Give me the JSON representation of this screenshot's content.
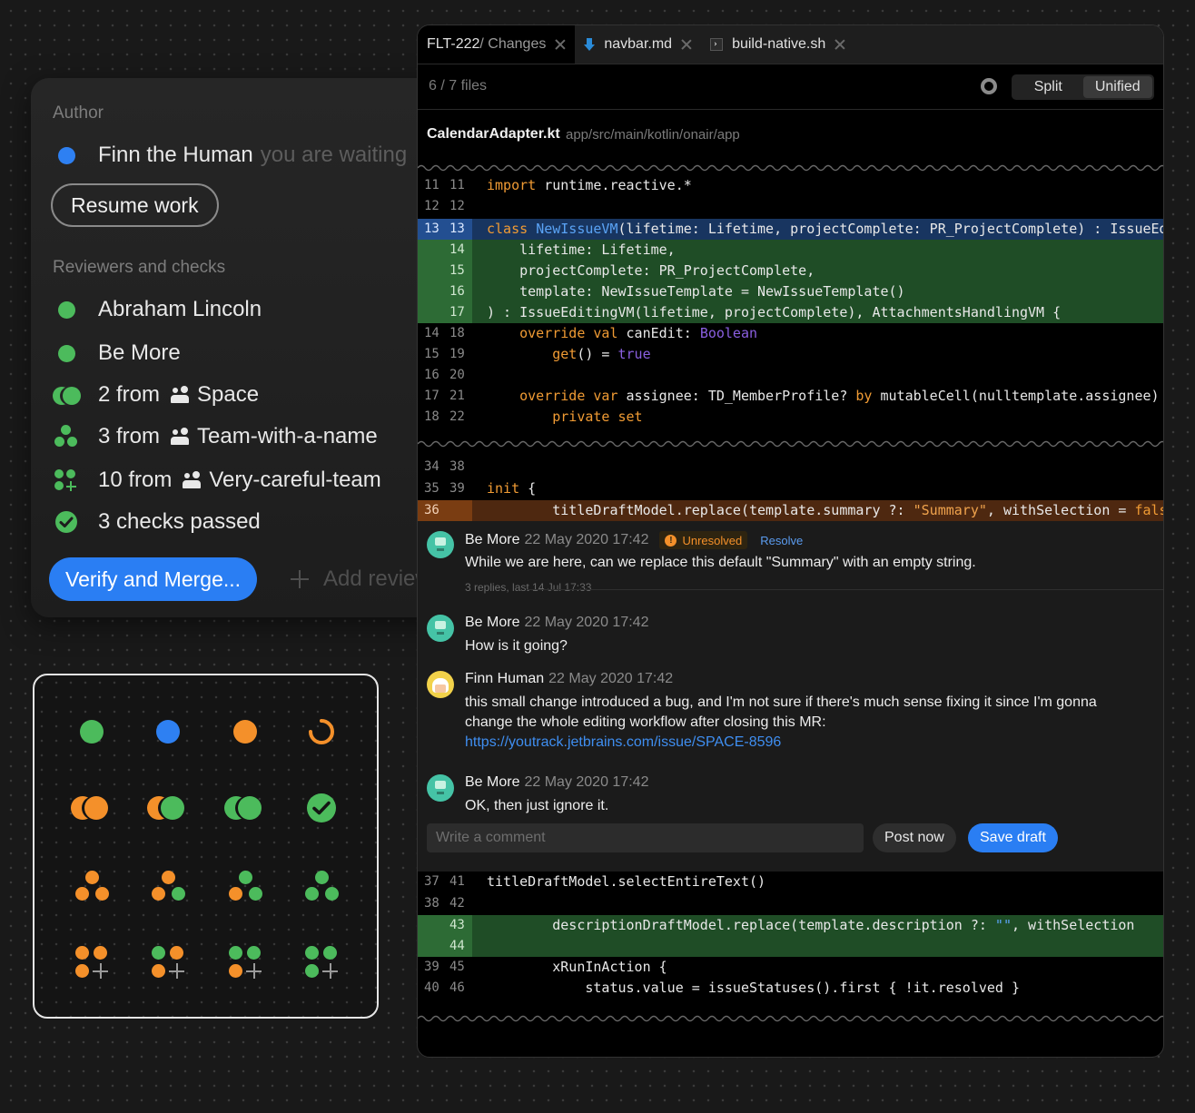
{
  "review_panel": {
    "author_label": "Author",
    "author": {
      "name": "Finn the Human",
      "status_text": "you are waiting",
      "status_color": "#2e80f2"
    },
    "resume_button": "Resume work",
    "reviewers_label": "Reviewers and checks",
    "reviewers": [
      {
        "text": "Abraham Lincoln",
        "icon": "green-dot-icon"
      },
      {
        "text": "Be More",
        "icon": "green-dot-icon"
      }
    ],
    "teams": [
      {
        "count": "2 from",
        "team": "Space",
        "icon": "two-green-dots-icon"
      },
      {
        "count": "3 from",
        "team": "Team-with-a-name",
        "icon": "three-green-dots-icon"
      },
      {
        "count": "10 from",
        "team": "Very-careful-team",
        "icon": "green-dots-plus-icon"
      }
    ],
    "checks": {
      "text": "3 checks passed",
      "icon": "check-circle-icon"
    },
    "verify_button": "Verify and Merge...",
    "add_reviewer": "Add reviewer",
    "colors": {
      "green": "#4cbb5c",
      "blue": "#2e80f2",
      "orange": "#f4902a",
      "accent": "#2a7ef3"
    }
  },
  "legend": {
    "rows": [
      [
        "green-dot-icon",
        "blue-dot-icon",
        "orange-dot-icon",
        "orange-spinner-icon"
      ],
      [
        "two-orange-dots-icon",
        "orange-green-dots-icon",
        "two-green-dots-icon",
        "check-circle-icon"
      ],
      [
        "three-orange-dots-icon",
        "two-orange-one-green-icon",
        "one-orange-two-green-icon",
        "three-green-dots-icon"
      ],
      [
        "orange-dots-plus-icon",
        "mixed-dots-plus-icon",
        "mostly-green-dots-plus-icon",
        "green-dots-plus-icon"
      ]
    ]
  },
  "code_review": {
    "tabs": [
      {
        "prefix": "FLT-222",
        "suffix": " / Changes",
        "icon": "none"
      },
      {
        "label": "navbar.md",
        "icon": "markdown-download-icon"
      },
      {
        "label": "build-native.sh",
        "icon": "terminal-icon"
      }
    ],
    "files_count": "6 / 7 files",
    "view_modes": [
      "Split",
      "Unified"
    ],
    "active_view_mode": "Unified",
    "file": {
      "name": "CalendarAdapter.kt",
      "path": "app/src/main/kotlin/onair/app"
    },
    "lines_a": [
      {
        "old": "11",
        "new": "11",
        "type": "normal"
      },
      {
        "old": "12",
        "new": "12",
        "type": "normal"
      },
      {
        "old": "13",
        "new": "13",
        "type": "selected"
      },
      {
        "old": "",
        "new": "14",
        "type": "added"
      },
      {
        "old": "",
        "new": "15",
        "type": "added"
      },
      {
        "old": "",
        "new": "16",
        "type": "added"
      },
      {
        "old": "",
        "new": "17",
        "type": "added"
      },
      {
        "old": "14",
        "new": "18",
        "type": "normal"
      },
      {
        "old": "15",
        "new": "19",
        "type": "normal"
      },
      {
        "old": "16",
        "new": "20",
        "type": "normal"
      },
      {
        "old": "17",
        "new": "21",
        "type": "normal"
      },
      {
        "old": "18",
        "new": "22",
        "type": "normal"
      }
    ],
    "lines_b": [
      {
        "old": "34",
        "new": "38",
        "type": "normal"
      },
      {
        "old": "35",
        "new": "39",
        "type": "normal"
      },
      {
        "old": "36",
        "new": "",
        "type": "comment"
      }
    ],
    "comments": [
      {
        "author": "Be More",
        "time": "22 May 2020 17:42",
        "badge": "Unresolved",
        "action": "Resolve",
        "body": "While we are here, can we replace this default \"Summary\" with an empty string.",
        "replies": "3 replies, last 14 Jul 17:33"
      },
      {
        "author": "Be More",
        "time": "22 May 2020 17:42",
        "body": "How is it going?"
      },
      {
        "author": "Finn Human",
        "time": "22 May 2020 17:42",
        "body": "this small change introduced a bug, and I'm not sure if there's much sense fixing it since I'm gonna change the whole editing workflow after closing this MR:",
        "link": "https://youtrack.jetbrains.com/issue/SPACE-8596"
      },
      {
        "author": "Be More",
        "time": "22 May 2020 17:42",
        "body": "OK, then just ignore it."
      }
    ],
    "comment_placeholder": "Write a comment",
    "post_button": "Post now",
    "save_button": "Save draft",
    "lines_c": [
      {
        "old": "37",
        "new": "41",
        "type": "normal"
      },
      {
        "old": "38",
        "new": "42",
        "type": "normal"
      },
      {
        "old": "",
        "new": "43",
        "type": "added"
      },
      {
        "old": "",
        "new": "44",
        "type": "added"
      },
      {
        "old": "39",
        "new": "45",
        "type": "normal"
      },
      {
        "old": "40",
        "new": "46",
        "type": "normal"
      }
    ],
    "code_colors": {
      "keyword": "#f09b34",
      "class": "#5aa3f5",
      "type": "#8a5fe0",
      "added_bg": "#1f4d26",
      "selected_bg": "#183560",
      "comment_bg": "#4e2810"
    }
  }
}
